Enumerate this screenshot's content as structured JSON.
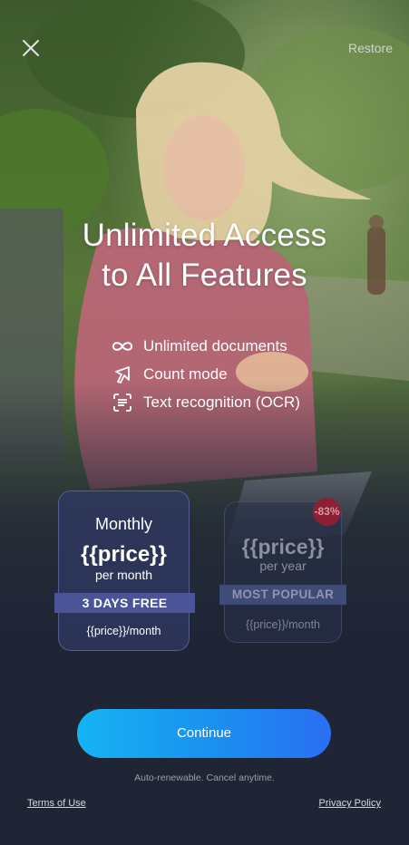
{
  "top_bar": {
    "close_icon": "close-icon",
    "restore_label": "Restore"
  },
  "headline": {
    "line1": "Unlimited Access",
    "line2": "to All Features"
  },
  "features": [
    {
      "icon": "infinity-icon",
      "label": "Unlimited documents"
    },
    {
      "icon": "count-cursor-icon",
      "label": "Count mode"
    },
    {
      "icon": "ocr-scan-icon",
      "label": "Text recognition (OCR)"
    }
  ],
  "plans": {
    "monthly": {
      "name": "Monthly",
      "price": "{{price}}",
      "period": "per month",
      "banner": "3 DAYS FREE",
      "sub_price": "{{price}}/month",
      "selected": true
    },
    "yearly": {
      "price": "{{price}}",
      "period": "per year",
      "banner": "MOST POPULAR",
      "sub_price": "{{price}}/month",
      "discount": "-83%",
      "selected": false
    }
  },
  "cta": {
    "continue_label": "Continue",
    "renew_note": "Auto-renewable. Cancel anytime."
  },
  "footer": {
    "terms_label": "Terms of Use",
    "privacy_label": "Privacy Policy"
  },
  "colors": {
    "background": "#1f2535",
    "accent_start": "#16b4f3",
    "accent_end": "#2a6ff2",
    "plan_selected": "#4b5496",
    "discount_badge": "#8b2035"
  }
}
